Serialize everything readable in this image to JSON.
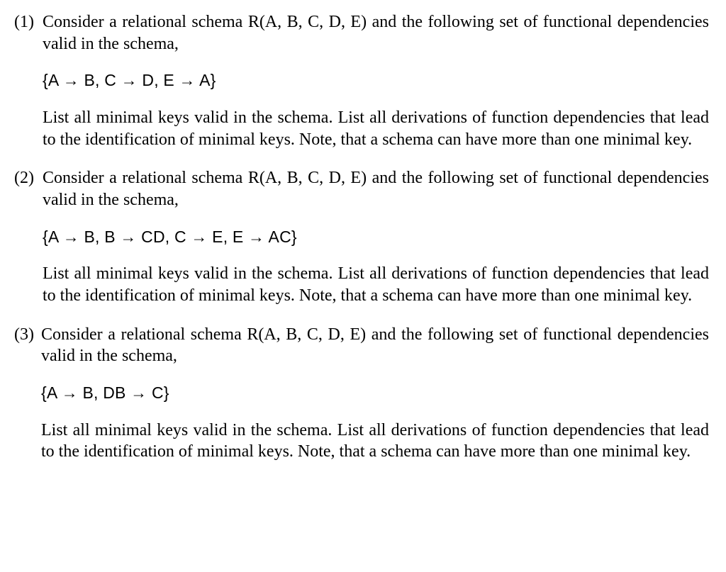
{
  "questions": [
    {
      "number": "(1)",
      "intro": "Consider a relational schema R(A, B, C, D, E) and the following set of functional dependencies valid in the schema,",
      "fd": "{A → B, C → D, E → A}",
      "task": "List all minimal keys valid in the schema. List all derivations of function dependencies that lead to the identification of minimal keys. Note, that a schema can have more than one minimal key."
    },
    {
      "number": "(2)",
      "intro": "Consider a relational schema R(A, B, C, D, E) and the following set of functional dependencies valid in the schema,",
      "fd": "{A → B, B → CD, C → E, E → AC}",
      "task": "List all minimal keys valid in the schema. List all derivations of function dependencies that lead to the identification of minimal keys. Note, that a schema can have more than one minimal key."
    },
    {
      "number": "(3)",
      "intro": "Consider a relational schema R(A, B, C, D, E) and the following set of functional dependencies valid in the schema,",
      "fd": "{A → B, DB → C}",
      "task": "List all minimal keys valid in the schema. List all derivations of function dependencies that lead to the identification of minimal keys. Note, that a schema can have more than one minimal key."
    }
  ]
}
